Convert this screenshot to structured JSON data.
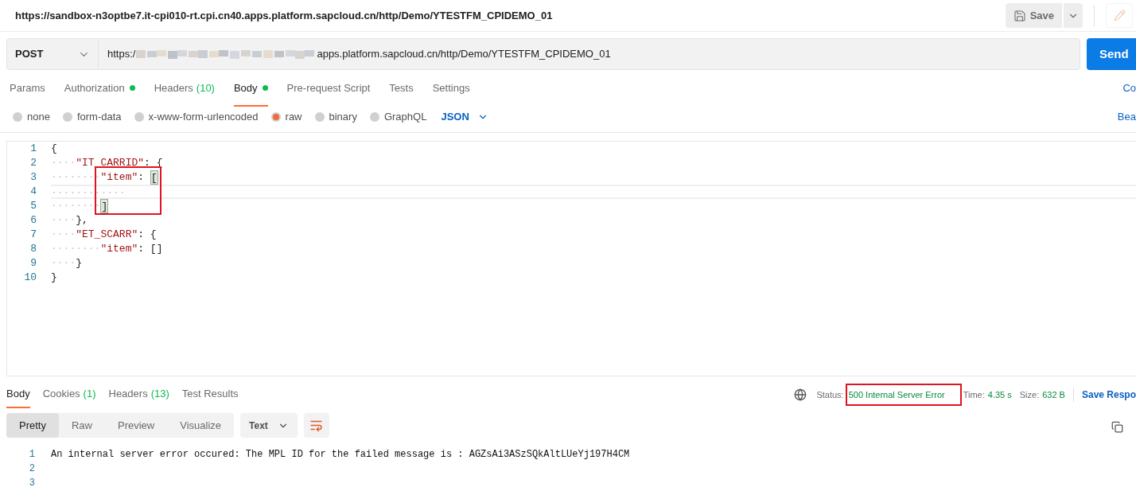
{
  "header": {
    "title": "https://sandbox-n3optbe7.it-cpi010-rt.cpi.cn40.apps.platform.sapcloud.cn/http/Demo/YTESTFM_CPIDEMO_01",
    "save_label": "Save"
  },
  "request": {
    "method": "POST",
    "url_prefix": "https:/",
    "url_rest": "apps.platform.sapcloud.cn/http/Demo/YTESTFM_CPIDEMO_01",
    "send_label": "Send"
  },
  "request_tabs": [
    {
      "label": "Params",
      "selected": false,
      "indicator": false
    },
    {
      "label": "Authorization",
      "selected": false,
      "indicator": true
    },
    {
      "label": "Headers",
      "count": "(10)",
      "selected": false,
      "indicator": false
    },
    {
      "label": "Body",
      "selected": true,
      "indicator": true
    },
    {
      "label": "Pre-request Script",
      "selected": false,
      "indicator": false
    },
    {
      "label": "Tests",
      "selected": false,
      "indicator": false
    },
    {
      "label": "Settings",
      "selected": false,
      "indicator": false
    }
  ],
  "request_tabs_right": "Co",
  "body_types": [
    {
      "label": "none",
      "selected": false
    },
    {
      "label": "form-data",
      "selected": false
    },
    {
      "label": "x-www-form-urlencoded",
      "selected": false
    },
    {
      "label": "raw",
      "selected": true
    },
    {
      "label": "binary",
      "selected": false
    },
    {
      "label": "GraphQL",
      "selected": false
    }
  ],
  "body_format": "JSON",
  "body_types_right": "Bea",
  "editor_lines": [
    {
      "number": "1",
      "current": false,
      "tokens": [
        {
          "kind": "punct",
          "text": "{"
        }
      ]
    },
    {
      "number": "2",
      "current": false,
      "tokens": [
        {
          "kind": "ws",
          "text": "····"
        },
        {
          "kind": "key",
          "text": "\"IT_CARRID\""
        },
        {
          "kind": "punct",
          "text": ": {"
        }
      ]
    },
    {
      "number": "3",
      "current": false,
      "tokens": [
        {
          "kind": "ws",
          "text": "········"
        },
        {
          "kind": "key",
          "text": "\"item\""
        },
        {
          "kind": "punct",
          "text": ": "
        },
        {
          "kind": "match",
          "text": "["
        }
      ]
    },
    {
      "number": "4",
      "current": true,
      "tokens": [
        {
          "kind": "ws",
          "text": "············"
        }
      ]
    },
    {
      "number": "5",
      "current": false,
      "tokens": [
        {
          "kind": "ws",
          "text": "········"
        },
        {
          "kind": "match",
          "text": "]"
        }
      ]
    },
    {
      "number": "6",
      "current": false,
      "tokens": [
        {
          "kind": "ws",
          "text": "····"
        },
        {
          "kind": "punct",
          "text": "},"
        }
      ]
    },
    {
      "number": "7",
      "current": false,
      "tokens": [
        {
          "kind": "ws",
          "text": "····"
        },
        {
          "kind": "key",
          "text": "\"ET_SCARR\""
        },
        {
          "kind": "punct",
          "text": ": {"
        }
      ]
    },
    {
      "number": "8",
      "current": false,
      "tokens": [
        {
          "kind": "ws",
          "text": "········"
        },
        {
          "kind": "key",
          "text": "\"item\""
        },
        {
          "kind": "punct",
          "text": ": []"
        }
      ]
    },
    {
      "number": "9",
      "current": false,
      "tokens": [
        {
          "kind": "ws",
          "text": "····"
        },
        {
          "kind": "punct",
          "text": "}"
        }
      ]
    },
    {
      "number": "10",
      "current": false,
      "tokens": [
        {
          "kind": "punct",
          "text": "}"
        }
      ]
    }
  ],
  "response_tabs": [
    {
      "label": "Body",
      "selected": true
    },
    {
      "label": "Cookies",
      "count": "(1)",
      "selected": false
    },
    {
      "label": "Headers",
      "count": "(13)",
      "selected": false
    },
    {
      "label": "Test Results",
      "selected": false
    }
  ],
  "response_status": {
    "status_label": "Status:",
    "status_value": "500 Internal Server Error",
    "time_label": "Time:",
    "time_value": "4.35 s",
    "size_label": "Size:",
    "size_value": "632 B",
    "save_response": "Save Respo"
  },
  "view_modes": [
    {
      "label": "Pretty",
      "selected": true
    },
    {
      "label": "Raw",
      "selected": false
    },
    {
      "label": "Preview",
      "selected": false
    },
    {
      "label": "Visualize",
      "selected": false
    }
  ],
  "response_format": "Text",
  "response_lines": [
    {
      "number": "1",
      "text": "An internal server error occured: The MPL ID for the failed message is : AGZsAi3ASzSQkAltLUeYj197H4CM"
    },
    {
      "number": "2"
    },
    {
      "number": "3"
    }
  ]
}
